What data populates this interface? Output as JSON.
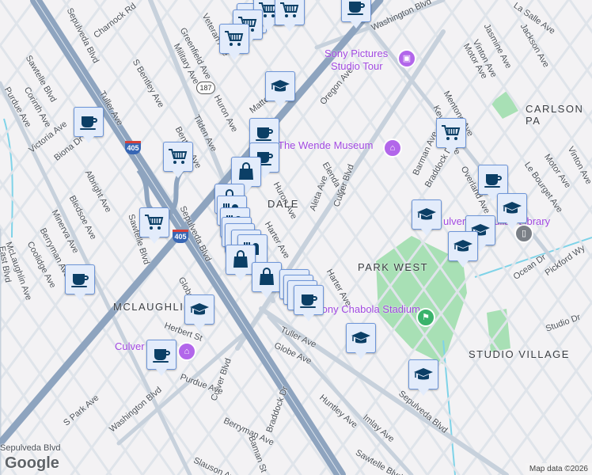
{
  "map": {
    "colors": {
      "background": "#f3f2f4",
      "freeway": "#8ea4bf",
      "arterial": "#c7d1dc",
      "street": "#dfe4ea",
      "park": "#a8e0b5",
      "water": "#7fd3e8",
      "marker_bg": "#e3ecfb",
      "marker_border": "#6d95d8",
      "icon": "#0b3f66",
      "poi": "#a149e0"
    },
    "neighborhoods": [
      "CARLSON PA",
      "PARK WEST",
      "MCLAUGHLIN",
      "STUDIO VILLAGE",
      "DALE"
    ],
    "pois": [
      {
        "name_line1": "Sony Pictures",
        "name_line2": "Studio Tour",
        "icon": "camera-icon"
      },
      {
        "name_line1": "The Wende Museum",
        "name_line2": "",
        "icon": "museum-icon"
      },
      {
        "name_line1": "Sony Chabola Stadium",
        "name_line2": "",
        "icon": "stadium-icon"
      },
      {
        "name_line1": "Culver City",
        "name_line2": "",
        "icon": "city-hall-icon"
      },
      {
        "name_line1": "ulver City Julian Library",
        "name_line2": "",
        "icon": "library-icon"
      }
    ],
    "streets": [
      "Sepulveda Blvd",
      "Charnock Rd",
      "Sawtelle Blvd",
      "S Bentley Ave",
      "Tuller Ave",
      "Greenfield Ave",
      "Military Ave",
      "Veteran Ave",
      "Huron Ave",
      "Tilden Ave",
      "Bentley Ave",
      "Matteson Ave",
      "Victoria Ave",
      "Biona Dr",
      "Corinth Ave",
      "Purdue Ave",
      "Albright Ave",
      "Bledsoe Ave",
      "Minerva Ave",
      "Berryman Ave",
      "Coolidge Ave",
      "McLaughlin Ave",
      "East Blvd",
      "Sawtelle Blvd",
      "Globe Ave",
      "Sepulveda Blvd",
      "Harter Ave",
      "Aleta Ave",
      "Elenda St",
      "Culver Blvd",
      "Oregon Ave",
      "Washington Blvd",
      "Huron Ave",
      "Harter Ave",
      "Barman Ave",
      "Braddock Dr",
      "Keystone Ave",
      "Mentone Ave",
      "Motor Ave",
      "Vinton Ave",
      "Jasmine Ave",
      "Jackson Ave",
      "La Salle Ave",
      "Overland Ave",
      "Le Bourget Ave",
      "Motor Ave",
      "Vinton Ave",
      "Ocean Dr",
      "Pickford Wy",
      "Studio Dr",
      "Herbert St",
      "Tuller Ave",
      "Globe Ave",
      "Culver Blvd",
      "Purdue Ave",
      "Washington Blvd",
      "S Park Ave",
      "Berryman Ave",
      "Baman St",
      "Braddock Dr",
      "Huntley Ave",
      "Imlay Ave",
      "Sepulveda Blvd",
      "Sawtelle Blvd",
      "Slauson Ave",
      "Sepulveda Blvd"
    ],
    "shields": {
      "interstate": "405",
      "state_route": "187"
    },
    "markers": [
      "coffee",
      "cart",
      "cart",
      "cart",
      "cart",
      "cart",
      "grad",
      "coffee",
      "coffee",
      "coffee",
      "cart",
      "cart",
      "bag",
      "bag",
      "grad",
      "coffee",
      "grad",
      "grad",
      "grad",
      "cart",
      "store",
      "store",
      "store",
      "store",
      "store",
      "store",
      "bag",
      "bag",
      "coffee",
      "grad",
      "coffee",
      "coffee",
      "coffee",
      "coffee",
      "grad",
      "coffee",
      "grad"
    ],
    "attribution": "Map data ©2026",
    "logo": "Google"
  }
}
